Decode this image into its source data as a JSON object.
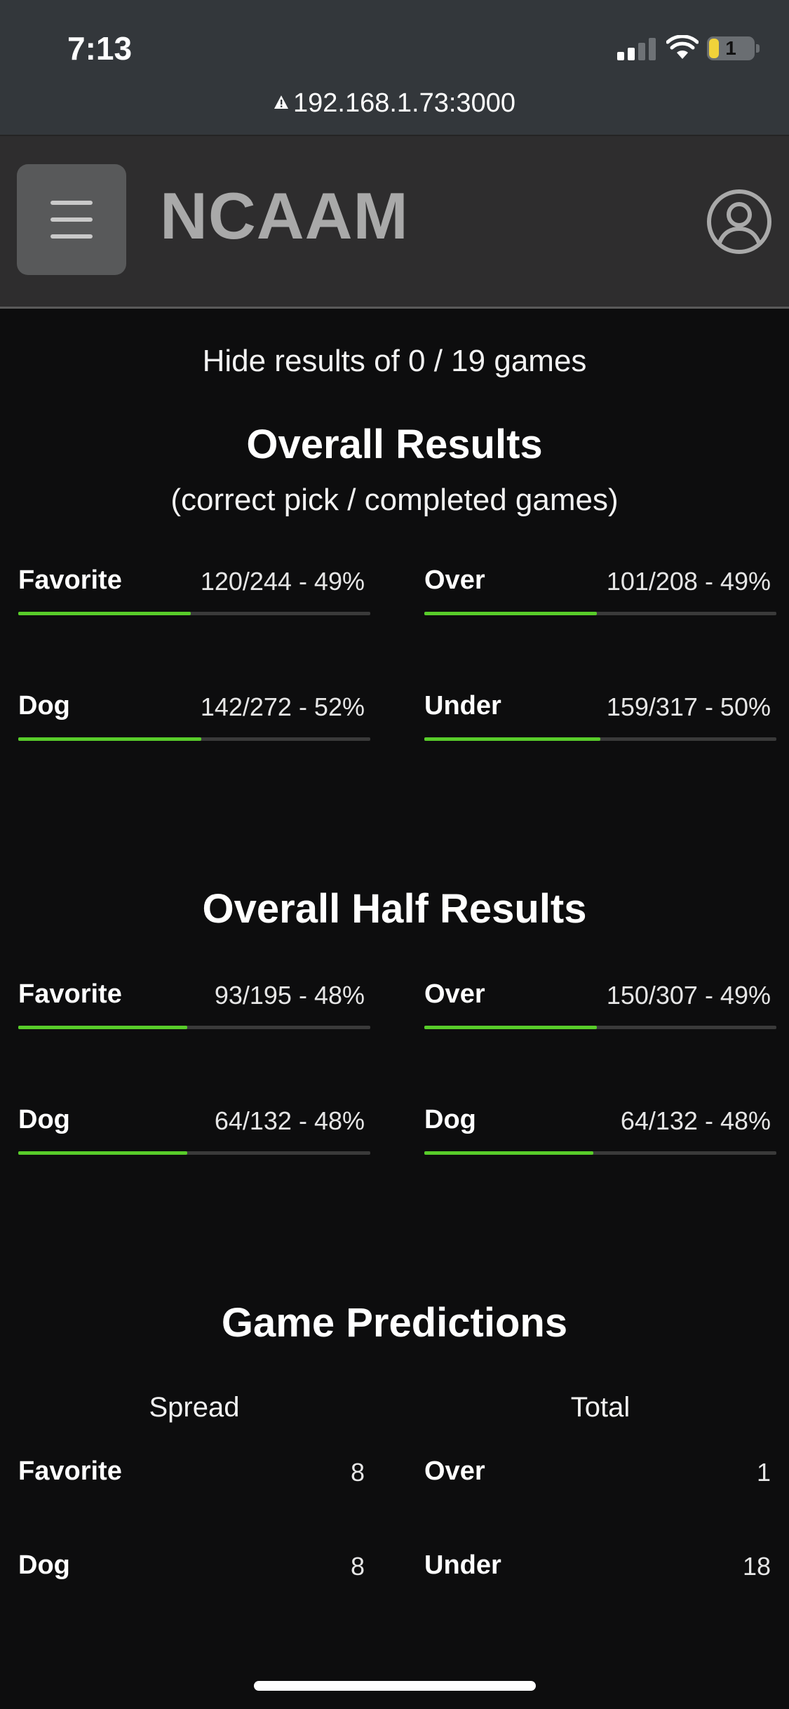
{
  "status_bar": {
    "time": "7:13",
    "battery": "1"
  },
  "browser": {
    "url": "192.168.1.73:3000"
  },
  "header": {
    "title": "NCAAM"
  },
  "hide_results": "Hide results of 0 / 19 games",
  "overall": {
    "title": "Overall Results",
    "subtitle": "(correct pick / completed games)",
    "stats": [
      {
        "label": "Favorite",
        "value": "120/244 - 49%",
        "progress": 0.49
      },
      {
        "label": "Over",
        "value": "101/208 - 49%",
        "progress": 0.49
      },
      {
        "label": "Dog",
        "value": "142/272 - 52%",
        "progress": 0.52
      },
      {
        "label": "Under",
        "value": "159/317 - 50%",
        "progress": 0.5
      }
    ]
  },
  "half": {
    "title": "Overall Half Results",
    "stats": [
      {
        "label": "Favorite",
        "value": "93/195 - 48%",
        "progress": 0.48
      },
      {
        "label": "Over",
        "value": "150/307 - 49%",
        "progress": 0.49
      },
      {
        "label": "Dog",
        "value": "64/132 - 48%",
        "progress": 0.48
      },
      {
        "label": "Dog",
        "value": "64/132 - 48%",
        "progress": 0.48
      }
    ]
  },
  "predictions": {
    "title": "Game Predictions",
    "spread": {
      "heading": "Spread",
      "rows": [
        {
          "label": "Favorite",
          "value": "8"
        },
        {
          "label": "Dog",
          "value": "8"
        }
      ]
    },
    "total": {
      "heading": "Total",
      "rows": [
        {
          "label": "Over",
          "value": "1"
        },
        {
          "label": "Under",
          "value": "18"
        }
      ]
    }
  },
  "colors": {
    "accent": "#58cc2a",
    "background": "#0d0d0e",
    "header_bg": "#2e2d2e"
  },
  "icons": {
    "menu": "hamburger-icon",
    "account": "user-circle-icon",
    "warning": "warning-icon"
  }
}
